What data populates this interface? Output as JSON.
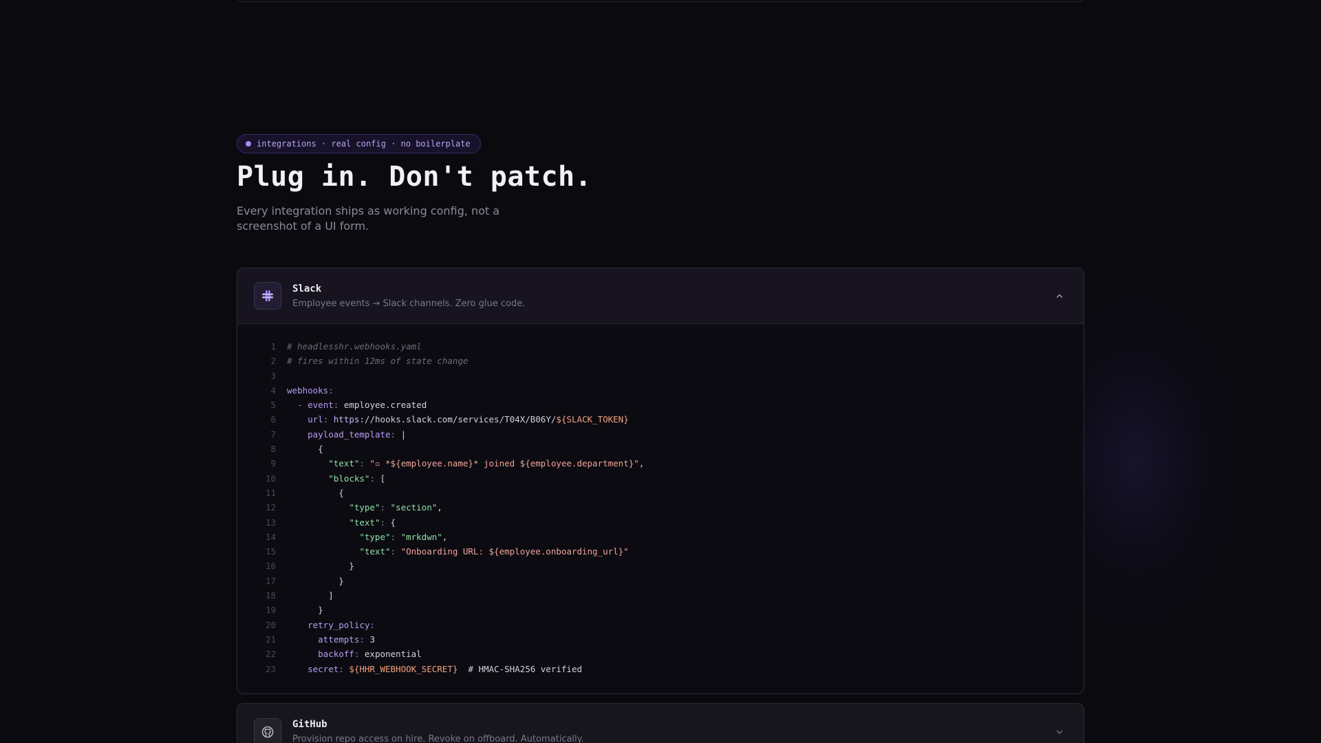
{
  "hero": {
    "badge": "integrations · real config · no boilerplate",
    "headline": "Plug in. Don't patch.",
    "subtitle": "Every integration ships as working config, not a screenshot of a UI form."
  },
  "colors": {
    "accent": "#a48cf2",
    "background": "#0b0a0f"
  },
  "integrations": [
    {
      "name": "Slack",
      "description": "Employee events → Slack channels. Zero glue code.",
      "icon": "slack-icon",
      "expanded": true,
      "code_lines": [
        [
          [
            "comment",
            "# headlesshr.webhooks.yaml"
          ]
        ],
        [
          [
            "comment",
            "# fires within 12ms of state change"
          ]
        ],
        [],
        [
          [
            "key",
            "webhooks"
          ],
          [
            "punc",
            ":"
          ]
        ],
        [
          [
            "plain",
            "  "
          ],
          [
            "punc",
            "- "
          ],
          [
            "key",
            "event"
          ],
          [
            "punc",
            ": "
          ],
          [
            "plain",
            "employee.created"
          ]
        ],
        [
          [
            "plain",
            "    "
          ],
          [
            "key",
            "url"
          ],
          [
            "punc",
            ": "
          ],
          [
            "url",
            "https"
          ],
          [
            "plain",
            "://hooks.slack.com/services/T04X/B06Y/"
          ],
          [
            "var",
            "${SLACK_TOKEN}"
          ]
        ],
        [
          [
            "plain",
            "    "
          ],
          [
            "key",
            "payload_template"
          ],
          [
            "punc",
            ": "
          ],
          [
            "plain",
            "|"
          ]
        ],
        [
          [
            "plain",
            "      {"
          ]
        ],
        [
          [
            "plain",
            "        "
          ],
          [
            "jkey",
            "\"text\""
          ],
          [
            "punc",
            ": "
          ],
          [
            "str",
            "\"▫ *${employee.name}* joined ${employee.department}\""
          ],
          [
            "plain",
            ","
          ]
        ],
        [
          [
            "plain",
            "        "
          ],
          [
            "jkey",
            "\"blocks\""
          ],
          [
            "punc",
            ": "
          ],
          [
            "plain",
            "["
          ]
        ],
        [
          [
            "plain",
            "          {"
          ]
        ],
        [
          [
            "plain",
            "            "
          ],
          [
            "jkey",
            "\"type\""
          ],
          [
            "punc",
            ": "
          ],
          [
            "jkey",
            "\"section\""
          ],
          [
            "plain",
            ","
          ]
        ],
        [
          [
            "plain",
            "            "
          ],
          [
            "jkey",
            "\"text\""
          ],
          [
            "punc",
            ": "
          ],
          [
            "plain",
            "{"
          ]
        ],
        [
          [
            "plain",
            "              "
          ],
          [
            "jkey",
            "\"type\""
          ],
          [
            "punc",
            ": "
          ],
          [
            "jkey",
            "\"mrkdwn\""
          ],
          [
            "plain",
            ","
          ]
        ],
        [
          [
            "plain",
            "              "
          ],
          [
            "jkey",
            "\"text\""
          ],
          [
            "punc",
            ": "
          ],
          [
            "str",
            "\"Onboarding URL: ${employee.onboarding_url}\""
          ]
        ],
        [
          [
            "plain",
            "            }"
          ]
        ],
        [
          [
            "plain",
            "          }"
          ]
        ],
        [
          [
            "plain",
            "        ]"
          ]
        ],
        [
          [
            "plain",
            "      }"
          ]
        ],
        [
          [
            "plain",
            "    "
          ],
          [
            "key",
            "retry_policy"
          ],
          [
            "punc",
            ":"
          ]
        ],
        [
          [
            "plain",
            "      "
          ],
          [
            "key",
            "attempts"
          ],
          [
            "punc",
            ": "
          ],
          [
            "plain",
            "3"
          ]
        ],
        [
          [
            "plain",
            "      "
          ],
          [
            "key",
            "backoff"
          ],
          [
            "punc",
            ": "
          ],
          [
            "plain",
            "exponential"
          ]
        ],
        [
          [
            "plain",
            "    "
          ],
          [
            "key",
            "secret"
          ],
          [
            "punc",
            ": "
          ],
          [
            "var",
            "${HHR_WEBHOOK_SECRET}"
          ],
          [
            "plain",
            "  # HMAC-SHA256 verified"
          ]
        ]
      ]
    },
    {
      "name": "GitHub",
      "description": "Provision repo access on hire. Revoke on offboard. Automatically.",
      "icon": "github-icon",
      "expanded": false
    }
  ]
}
